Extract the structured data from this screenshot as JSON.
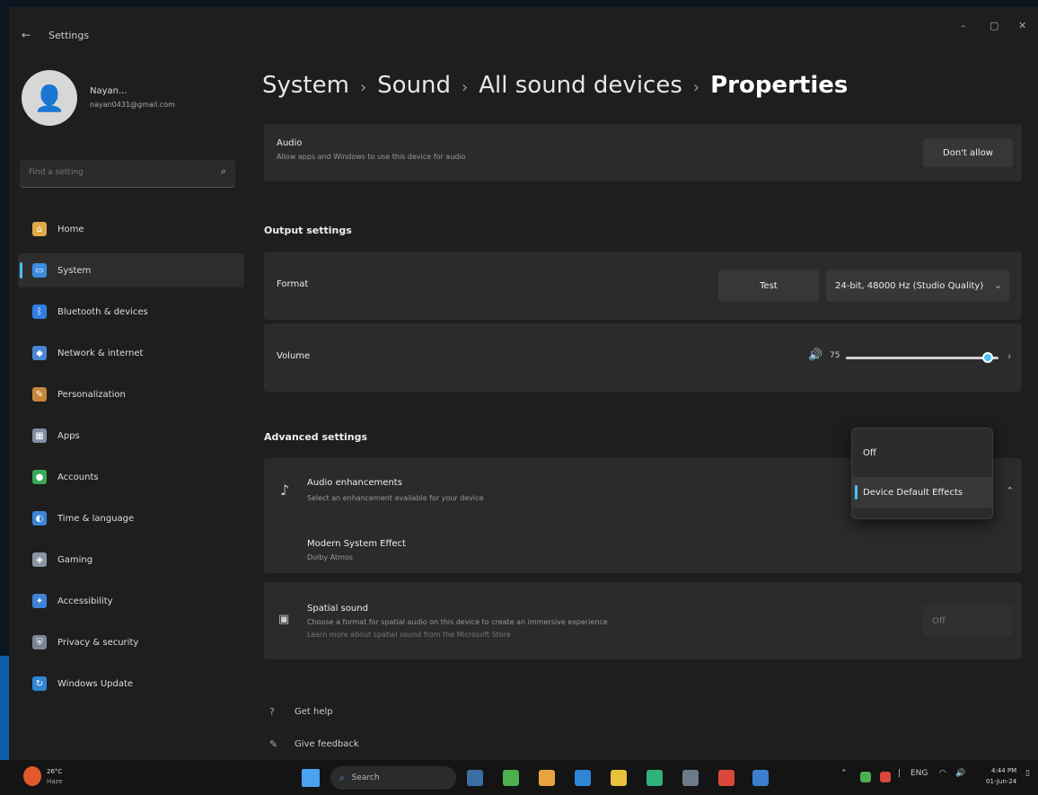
{
  "window": {
    "title": "Settings",
    "back": "←",
    "minimize": "–",
    "maximize": "▢",
    "close": "✕"
  },
  "profile": {
    "name": "Nayan...",
    "email": "nayan0431@gmail.com"
  },
  "search": {
    "placeholder": "Find a setting",
    "icon": "search-icon"
  },
  "sidebar": {
    "items": [
      {
        "label": "Home",
        "icon": "home-icon",
        "color": "#e0a84a",
        "glyph": "⌂"
      },
      {
        "label": "System",
        "icon": "system-icon",
        "color": "#3b8de0",
        "glyph": "▭",
        "active": true
      },
      {
        "label": "Bluetooth & devices",
        "icon": "bluetooth-icon",
        "color": "#2f7fe0",
        "glyph": "ᛒ"
      },
      {
        "label": "Network & internet",
        "icon": "network-icon",
        "color": "#4a86d8",
        "glyph": "◆"
      },
      {
        "label": "Personalization",
        "icon": "brush-icon",
        "color": "#c6893c",
        "glyph": "✎"
      },
      {
        "label": "Apps",
        "icon": "apps-icon",
        "color": "#7f8ea3",
        "glyph": "▦"
      },
      {
        "label": "Accounts",
        "icon": "accounts-icon",
        "color": "#38a957",
        "glyph": "●"
      },
      {
        "label": "Time & language",
        "icon": "globe-icon",
        "color": "#3a86d8",
        "glyph": "◐"
      },
      {
        "label": "Gaming",
        "icon": "gaming-icon",
        "color": "#8b95a3",
        "glyph": "◈"
      },
      {
        "label": "Accessibility",
        "icon": "accessibility-icon",
        "color": "#3f84d6",
        "glyph": "✦"
      },
      {
        "label": "Privacy & security",
        "icon": "shield-icon",
        "color": "#7d8593",
        "glyph": "⛨"
      },
      {
        "label": "Windows Update",
        "icon": "update-icon",
        "color": "#2f86d6",
        "glyph": "↻"
      }
    ]
  },
  "breadcrumb": {
    "items": [
      "System",
      "Sound",
      "All sound devices"
    ],
    "current": "Properties",
    "sep": "›"
  },
  "audio_card": {
    "title": "Audio",
    "subtitle": "Allow apps and Windows to use this device for audio",
    "button": "Don't allow"
  },
  "output_settings": {
    "heading": "Output settings",
    "format_label": "Format",
    "test_button": "Test",
    "format_value": "24-bit, 48000 Hz (Studio Quality)",
    "volume_label": "Volume",
    "volume_value": "75",
    "volume_level": 0.93
  },
  "advanced": {
    "heading": "Advanced settings",
    "enhancements_title": "Audio enhancements",
    "enhancements_sub": "Select an enhancement available for your device",
    "effect_title": "Modern System Effect",
    "effect_sub": "Dolby Atmos",
    "spatial_title": "Spatial sound",
    "spatial_sub": "Choose a format for spatial audio on this device to create an immersive experience",
    "spatial_sub2": "Learn more about spatial sound from the Microsoft Store",
    "spatial_value": "Off"
  },
  "dropdown": {
    "options": [
      "Off",
      "Device Default Effects"
    ],
    "selected": "Device Default Effects"
  },
  "help": {
    "get_help": "Get help",
    "feedback": "Give feedback"
  },
  "taskbar": {
    "weather_temp": "26°C",
    "weather_desc": "Haze",
    "search_label": "Search",
    "time": "4:44 PM",
    "date": "01-Jun-24",
    "tray_text": "ENG"
  },
  "colors": {
    "accent": "#4cc2ff",
    "card": "#2b2b2b",
    "window": "#1e1e1e"
  }
}
